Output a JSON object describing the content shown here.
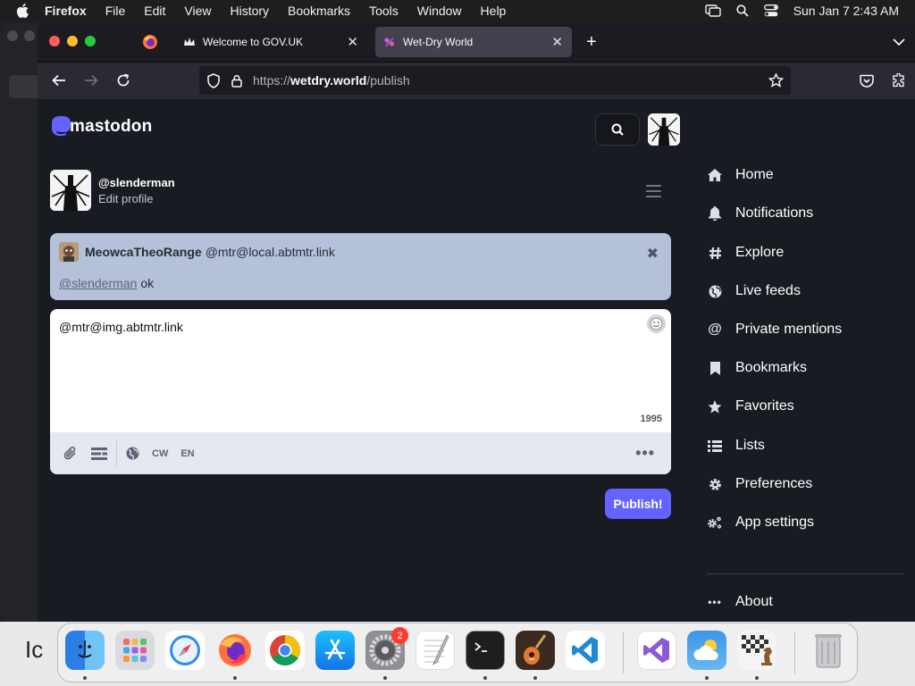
{
  "menubar": {
    "app": "Firefox",
    "items": [
      "File",
      "Edit",
      "View",
      "History",
      "Bookmarks",
      "Tools",
      "Window",
      "Help"
    ],
    "clock": "Sun Jan 7  2:43 AM"
  },
  "browser": {
    "tabs": [
      {
        "label": "Welcome to GOV.UK",
        "icon": "crown-icon"
      },
      {
        "label": "Wet-Dry World",
        "icon": "mastodon-favicon"
      }
    ],
    "url": {
      "scheme": "https://",
      "domain": "wetdry.world",
      "path": "/publish"
    }
  },
  "mastodon": {
    "logo": "mastodon",
    "profile": {
      "handle": "@slenderman",
      "edit_label": "Edit profile"
    },
    "reply_to": {
      "name": "MeowcaTheoRange",
      "acct": "@mtr@local.abtmtr.link",
      "mention": "@slenderman",
      "text": "ok"
    },
    "compose": {
      "text": "@mtr@img.abtmtr.link",
      "remaining": "1995",
      "cw_label": "CW",
      "lang_label": "EN"
    },
    "publish_label": "Publish!",
    "nav": [
      {
        "label": "Home",
        "icon": "home-icon"
      },
      {
        "label": "Notifications",
        "icon": "bell-icon"
      },
      {
        "label": "Explore",
        "icon": "hashtag-icon"
      },
      {
        "label": "Live feeds",
        "icon": "globe-icon"
      },
      {
        "label": "Private mentions",
        "icon": "at-icon"
      },
      {
        "label": "Bookmarks",
        "icon": "bookmark-icon"
      },
      {
        "label": "Favorites",
        "icon": "star-icon"
      },
      {
        "label": "Lists",
        "icon": "list-icon"
      },
      {
        "label": "Preferences",
        "icon": "gear-icon"
      },
      {
        "label": "App settings",
        "icon": "cogs-icon"
      },
      {
        "label": "About",
        "icon": "ellipsis-icon"
      }
    ]
  },
  "dock": {
    "apps": [
      "Finder",
      "Launchpad",
      "Safari",
      "Firefox",
      "Chrome",
      "App Store",
      "System Settings",
      "TextEdit",
      "Terminal",
      "GarageBand",
      "Visual Studio Code",
      "Visual Studio",
      "Weather",
      "Chess",
      "Trash"
    ],
    "system_settings_badge": "2"
  },
  "background": {
    "partial_text": "Ic"
  },
  "colors": {
    "accent": "#6364ff",
    "reply_bg": "#b5c1d9",
    "page_bg": "#191b22"
  }
}
